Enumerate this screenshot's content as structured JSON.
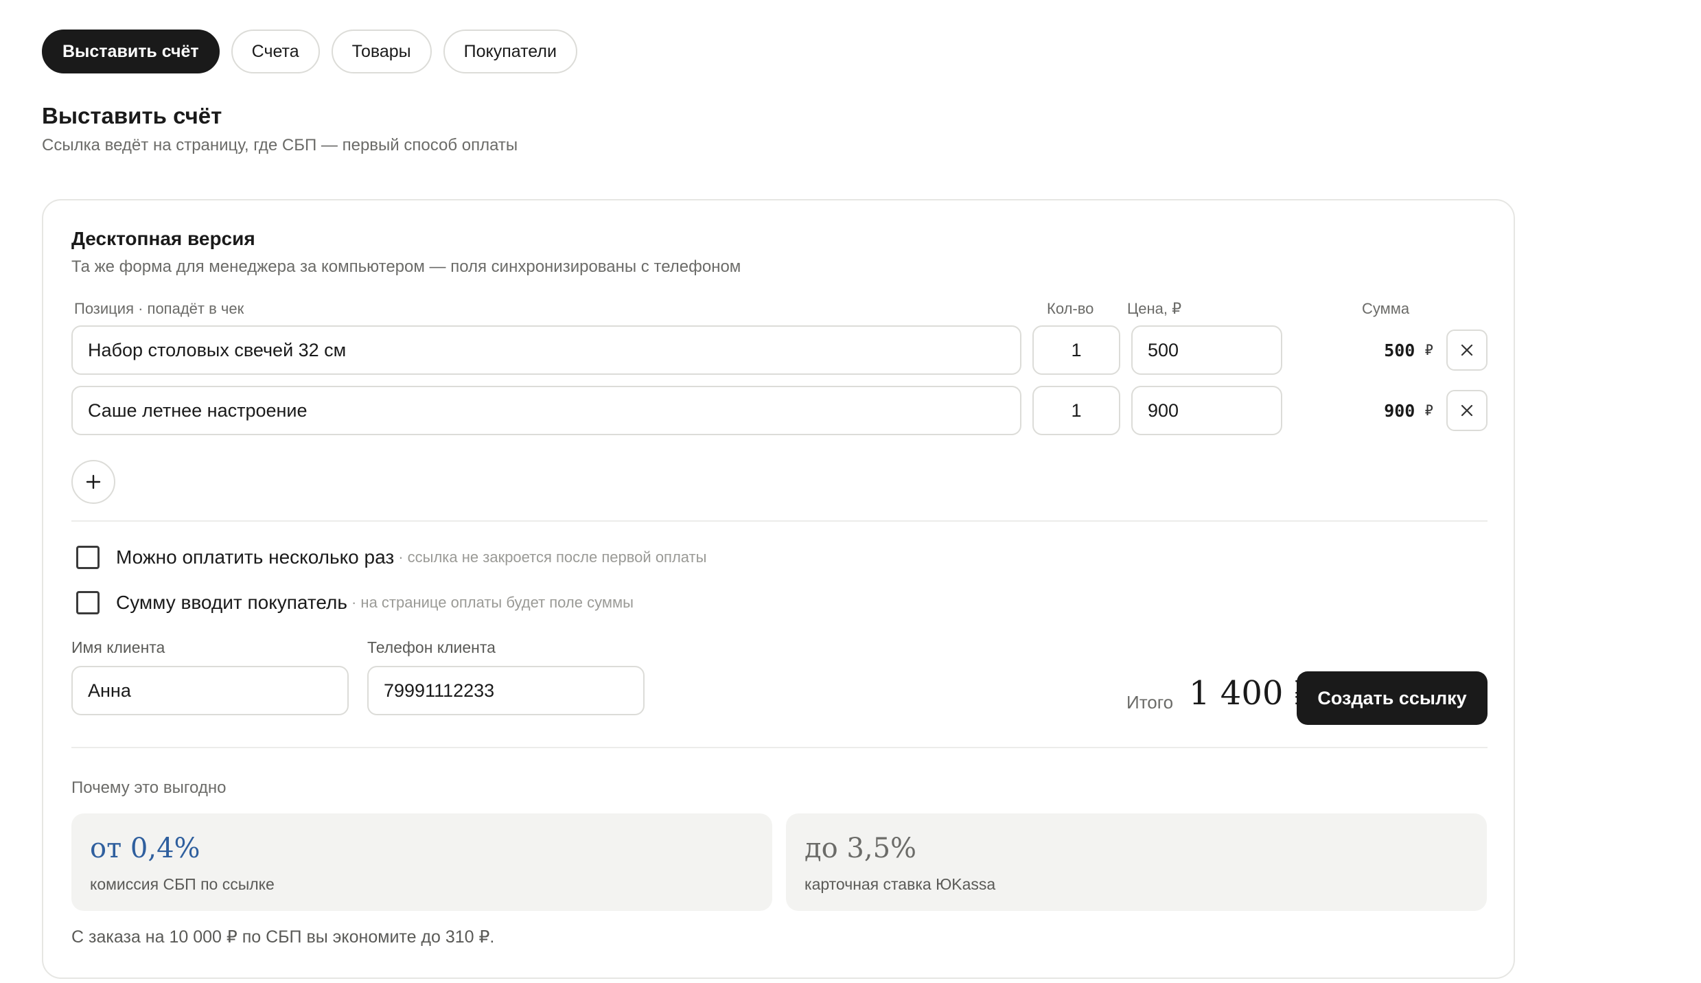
{
  "nav": {
    "tabs": [
      {
        "label": "Выставить счёт",
        "active": true
      },
      {
        "label": "Счета"
      },
      {
        "label": "Товары"
      },
      {
        "label": "Покупатели"
      }
    ]
  },
  "header": {
    "title": "Выставить счёт",
    "subtitle": "Ссылка ведёт на страницу, где СБП — первый способ оплаты"
  },
  "card": {
    "title": "Десктопная версия",
    "subtitle": "Та же форма для менеджера за компьютером — поля синхронизированы с телефоном",
    "columns": {
      "position": "Позиция · попадёт в чек",
      "qty": "Кол-во",
      "price": "Цена, ₽",
      "sum": "Сумма"
    },
    "items": [
      {
        "name": "Набор столовых свечей 32 см",
        "qty": "1",
        "price": "500",
        "sum": "500",
        "currency": "₽"
      },
      {
        "name": "Саше летнее настроение",
        "qty": "1",
        "price": "900",
        "sum": "900",
        "currency": "₽"
      }
    ],
    "add_icon": "plus-icon",
    "remove_icon": "close-icon",
    "options": [
      {
        "label": "Можно оплатить несколько раз",
        "hint": "· ссылка не закроется после первой оплаты",
        "checked": false
      },
      {
        "label": "Сумму вводит покупатель",
        "hint": "· на странице оплаты будет поле суммы",
        "checked": false
      }
    ],
    "client": {
      "name_label": "Имя клиента",
      "name_value": "Анна",
      "phone_label": "Телефон клиента",
      "phone_value": "79991112233"
    },
    "total": {
      "label": "Итого",
      "value": "1 400 ₽"
    },
    "create_button": "Создать ссылку",
    "why": {
      "title": "Почему это выгодно",
      "benefits": [
        {
          "big": "от 0,4%",
          "small": "комиссия СБП по ссылке",
          "color": "#2f5f9e"
        },
        {
          "big": "до 3,5%",
          "small": "карточная ставка ЮKassa",
          "color": "#6b6b68"
        }
      ],
      "savings": "С заказа на 10 000 ₽ по СБП вы экономите до 310 ₽."
    }
  },
  "colors": {
    "primary": "#1a1a1a",
    "accent_blue": "#2f5f9e",
    "muted": "#6b6b68",
    "border": "#dcdcd8",
    "panel": "#f3f3f1"
  }
}
